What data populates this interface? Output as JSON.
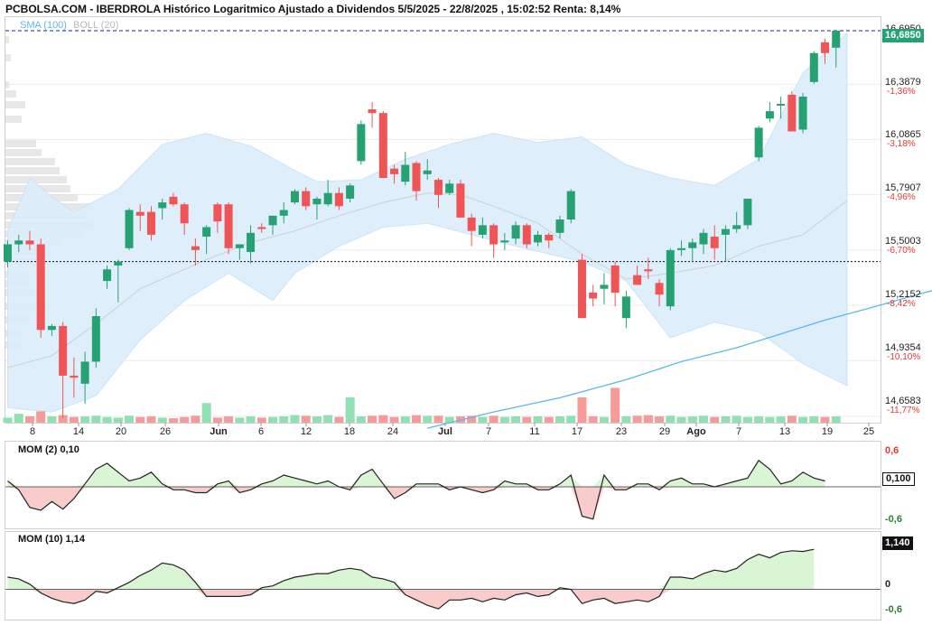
{
  "title": "PCBOLSA.COM - IBERDROLA Histórico Logaritmico Ajustado a Dividendos 5/5/2025 - 22/8/2025 , 15:02:52 Renta: 8,14%",
  "legend": {
    "sma": "SMA (100)",
    "boll": "BOLL (20)"
  },
  "colors": {
    "up": "#26a172",
    "down": "#f05454",
    "sma": "#5bb8ec",
    "band": "#dcedfb",
    "mom_pos": "#d9f5d3",
    "mom_neg": "#f9cccc"
  },
  "chart_data": [
    {
      "type": "candlestick",
      "ylim": [
        14.6583,
        16.695
      ],
      "y_scale": "log",
      "y_ticks": [
        {
          "value": "16,6950",
          "pct": ""
        },
        {
          "value": "16,3879",
          "pct": "-1,36%"
        },
        {
          "value": "16,0865",
          "pct": "-3,18%"
        },
        {
          "value": "15,7907",
          "pct": "-4,96%"
        },
        {
          "value": "15,5003",
          "pct": "-6,70%"
        },
        {
          "value": "15,2152",
          "pct": "-8,42%"
        },
        {
          "value": "14,9354",
          "pct": "-10,10%"
        },
        {
          "value": "14,6583",
          "pct": "-11,77%"
        }
      ],
      "x_ticks": [
        {
          "label": "8",
          "month": false
        },
        {
          "label": "14",
          "month": false
        },
        {
          "label": "20",
          "month": false
        },
        {
          "label": "26",
          "month": false
        },
        {
          "label": "Jun",
          "month": true
        },
        {
          "label": "6",
          "month": false
        },
        {
          "label": "12",
          "month": false
        },
        {
          "label": "18",
          "month": false
        },
        {
          "label": "24",
          "month": false
        },
        {
          "label": "Jul",
          "month": true
        },
        {
          "label": "7",
          "month": false
        },
        {
          "label": "11",
          "month": false
        },
        {
          "label": "17",
          "month": false
        },
        {
          "label": "23",
          "month": false
        },
        {
          "label": "29",
          "month": false
        },
        {
          "label": "Ago",
          "month": true
        },
        {
          "label": "7",
          "month": false
        },
        {
          "label": "13",
          "month": false
        },
        {
          "label": "19",
          "month": false
        },
        {
          "label": "25",
          "month": false
        }
      ],
      "last_price": "16,6850",
      "reference_level": 15.44,
      "candles": [
        [
          15.44,
          15.55,
          15.41,
          15.53,
          8
        ],
        [
          15.53,
          15.58,
          15.49,
          15.55,
          14
        ],
        [
          15.55,
          15.6,
          15.5,
          15.53,
          10
        ],
        [
          15.53,
          15.56,
          15.05,
          15.09,
          18
        ],
        [
          15.09,
          15.12,
          15.06,
          15.11,
          10
        ],
        [
          15.11,
          15.13,
          14.65,
          14.86,
          12
        ],
        [
          14.86,
          14.95,
          14.75,
          14.85,
          9
        ],
        [
          14.82,
          14.98,
          14.72,
          14.93,
          10
        ],
        [
          14.93,
          15.2,
          14.9,
          15.16,
          11
        ],
        [
          15.34,
          15.42,
          15.3,
          15.4,
          9
        ],
        [
          15.42,
          15.45,
          15.23,
          15.44,
          8
        ],
        [
          15.51,
          15.72,
          15.5,
          15.71,
          11
        ],
        [
          15.7,
          15.74,
          15.6,
          15.68,
          9
        ],
        [
          15.7,
          15.73,
          15.55,
          15.58,
          10
        ],
        [
          15.72,
          15.77,
          15.66,
          15.75,
          8
        ],
        [
          15.78,
          15.8,
          15.73,
          15.74,
          7
        ],
        [
          15.74,
          15.75,
          15.58,
          15.64,
          9
        ],
        [
          15.52,
          15.56,
          15.42,
          15.5,
          11
        ],
        [
          15.57,
          15.63,
          15.48,
          15.62,
          31
        ],
        [
          15.74,
          15.75,
          15.59,
          15.65,
          8
        ],
        [
          15.74,
          15.75,
          15.48,
          15.51,
          10
        ],
        [
          15.51,
          15.53,
          15.45,
          15.53,
          8
        ],
        [
          15.49,
          15.63,
          15.43,
          15.59,
          10
        ],
        [
          15.62,
          15.64,
          15.59,
          15.61,
          8
        ],
        [
          15.63,
          15.68,
          15.58,
          15.68,
          9
        ],
        [
          15.68,
          15.75,
          15.64,
          15.71,
          10
        ],
        [
          15.75,
          15.82,
          15.74,
          15.81,
          12
        ],
        [
          15.81,
          15.83,
          15.71,
          15.73,
          11
        ],
        [
          15.74,
          15.78,
          15.66,
          15.77,
          10
        ],
        [
          15.74,
          15.87,
          15.73,
          15.8,
          12
        ],
        [
          15.8,
          15.83,
          15.71,
          15.73,
          9
        ],
        [
          15.77,
          15.85,
          15.75,
          15.84,
          40
        ],
        [
          15.97,
          16.19,
          15.95,
          16.17,
          10
        ],
        [
          16.25,
          16.29,
          16.15,
          16.23,
          11
        ],
        [
          16.23,
          16.24,
          15.88,
          15.88,
          12
        ],
        [
          15.93,
          15.95,
          15.85,
          15.9,
          9
        ],
        [
          15.86,
          16.02,
          15.84,
          15.95,
          10
        ],
        [
          15.96,
          15.97,
          15.76,
          15.81,
          12
        ],
        [
          15.9,
          15.98,
          15.87,
          15.92,
          11
        ],
        [
          15.87,
          15.88,
          15.72,
          15.79,
          11
        ],
        [
          15.8,
          15.87,
          15.79,
          15.85,
          9
        ],
        [
          15.85,
          15.87,
          15.67,
          15.67,
          10
        ],
        [
          15.67,
          15.69,
          15.52,
          15.6,
          11
        ],
        [
          15.58,
          15.67,
          15.56,
          15.63,
          9
        ],
        [
          15.63,
          15.64,
          15.46,
          15.53,
          11
        ],
        [
          15.54,
          15.59,
          15.5,
          15.55,
          9
        ],
        [
          15.56,
          15.65,
          15.53,
          15.63,
          10
        ],
        [
          15.63,
          15.64,
          15.51,
          15.53,
          9
        ],
        [
          15.54,
          15.6,
          15.52,
          15.58,
          10
        ],
        [
          15.58,
          15.59,
          15.51,
          15.55,
          9
        ],
        [
          15.59,
          15.68,
          15.56,
          15.66,
          10
        ],
        [
          15.66,
          15.82,
          15.64,
          15.81,
          11
        ],
        [
          15.45,
          15.48,
          15.15,
          15.15,
          40
        ],
        [
          15.28,
          15.32,
          15.21,
          15.25,
          10
        ],
        [
          15.3,
          15.38,
          15.22,
          15.32,
          9
        ],
        [
          15.42,
          15.44,
          15.21,
          15.28,
          55
        ],
        [
          15.15,
          15.29,
          15.1,
          15.26,
          10
        ],
        [
          15.37,
          15.42,
          15.32,
          15.32,
          11
        ],
        [
          15.4,
          15.46,
          15.35,
          15.39,
          12
        ],
        [
          15.33,
          15.35,
          15.21,
          15.27,
          10
        ],
        [
          15.21,
          15.51,
          15.19,
          15.5,
          11
        ],
        [
          15.5,
          15.55,
          15.47,
          15.51,
          9
        ],
        [
          15.51,
          15.56,
          15.44,
          15.54,
          10
        ],
        [
          15.53,
          15.61,
          15.48,
          15.59,
          11
        ],
        [
          15.57,
          15.63,
          15.45,
          15.51,
          9
        ],
        [
          15.58,
          15.63,
          15.44,
          15.61,
          10
        ],
        [
          15.61,
          15.7,
          15.59,
          15.63,
          11
        ],
        [
          15.63,
          15.77,
          15.61,
          15.77,
          9
        ],
        [
          15.99,
          16.16,
          15.97,
          16.15,
          10
        ],
        [
          16.2,
          16.29,
          16.18,
          16.24,
          9
        ],
        [
          16.27,
          16.32,
          16.2,
          16.28,
          10
        ],
        [
          16.33,
          16.35,
          16.13,
          16.13,
          11
        ],
        [
          16.14,
          16.34,
          16.12,
          16.32,
          9
        ],
        [
          16.4,
          16.57,
          16.39,
          16.56,
          10
        ],
        [
          16.62,
          16.64,
          16.5,
          16.56,
          9
        ],
        [
          16.59,
          16.68,
          16.48,
          16.685,
          10
        ]
      ],
      "sma100": [
        [
          38,
          14.6
        ],
        [
          44,
          14.68
        ],
        [
          50,
          14.75
        ],
        [
          56,
          14.84
        ],
        [
          61,
          14.93
        ],
        [
          66,
          15.0
        ],
        [
          70,
          15.07
        ],
        [
          74,
          15.14
        ],
        [
          78,
          15.2
        ],
        [
          83,
          15.28
        ],
        [
          87,
          15.34
        ],
        [
          91,
          15.4
        ],
        [
          96,
          15.47
        ]
      ],
      "boll_mid": [
        [
          0,
          14.9
        ],
        [
          4,
          14.96
        ],
        [
          8,
          15.12
        ],
        [
          12,
          15.3
        ],
        [
          18,
          15.45
        ],
        [
          22,
          15.54
        ],
        [
          26,
          15.6
        ],
        [
          30,
          15.68
        ],
        [
          34,
          15.75
        ],
        [
          38,
          15.8
        ],
        [
          41,
          15.79
        ],
        [
          44,
          15.73
        ],
        [
          48,
          15.64
        ],
        [
          52,
          15.48
        ],
        [
          56,
          15.35
        ],
        [
          60,
          15.38
        ],
        [
          64,
          15.42
        ],
        [
          68,
          15.52
        ],
        [
          72,
          15.58
        ],
        [
          76,
          15.76
        ]
      ],
      "boll_upper": [
        [
          0,
          15.6
        ],
        [
          2,
          15.88
        ],
        [
          4,
          15.78
        ],
        [
          6,
          15.7
        ],
        [
          10,
          15.82
        ],
        [
          14,
          16.06
        ],
        [
          18,
          16.12
        ],
        [
          22,
          16.05
        ],
        [
          26,
          15.92
        ],
        [
          28,
          15.86
        ],
        [
          32,
          15.87
        ],
        [
          36,
          15.98
        ],
        [
          40,
          16.06
        ],
        [
          44,
          16.12
        ],
        [
          48,
          16.07
        ],
        [
          52,
          16.1
        ],
        [
          56,
          15.95
        ],
        [
          60,
          15.88
        ],
        [
          64,
          15.84
        ],
        [
          68,
          15.98
        ],
        [
          72,
          16.45
        ],
        [
          76,
          16.67
        ]
      ],
      "boll_lower": [
        [
          0,
          14.7
        ],
        [
          4,
          14.68
        ],
        [
          8,
          14.76
        ],
        [
          12,
          15.04
        ],
        [
          16,
          15.24
        ],
        [
          20,
          15.38
        ],
        [
          24,
          15.24
        ],
        [
          26,
          15.38
        ],
        [
          30,
          15.52
        ],
        [
          34,
          15.62
        ],
        [
          38,
          15.64
        ],
        [
          42,
          15.58
        ],
        [
          46,
          15.52
        ],
        [
          52,
          15.44
        ],
        [
          56,
          15.34
        ],
        [
          60,
          15.05
        ],
        [
          64,
          15.13
        ],
        [
          68,
          15.08
        ],
        [
          72,
          14.92
        ],
        [
          76,
          14.81
        ]
      ]
    },
    {
      "type": "line",
      "name": "MOM (2)",
      "label_text": "MOM (2)  0,10",
      "ylim": [
        -0.6,
        0.6
      ],
      "y_ticks": [
        "0,6",
        "-0,6"
      ],
      "last": "0,100",
      "values": [
        0.1,
        -0.05,
        -0.35,
        -0.4,
        -0.25,
        -0.38,
        -0.2,
        0.05,
        0.3,
        0.4,
        0.25,
        0.1,
        0.15,
        0.25,
        0.05,
        -0.05,
        -0.05,
        -0.1,
        -0.1,
        0.05,
        0.1,
        -0.1,
        -0.05,
        0.05,
        0.1,
        0.2,
        0.15,
        0.1,
        0.05,
        0.1,
        0.0,
        -0.05,
        0.2,
        0.3,
        0.05,
        -0.2,
        -0.1,
        0.05,
        0.05,
        0.05,
        -0.05,
        0.0,
        -0.05,
        -0.1,
        -0.05,
        0.1,
        0.05,
        0.05,
        -0.05,
        -0.05,
        0.05,
        0.2,
        -0.5,
        -0.55,
        0.2,
        -0.05,
        -0.05,
        0.05,
        0.05,
        -0.05,
        0.1,
        0.15,
        0.05,
        0.05,
        0.0,
        0.05,
        0.1,
        0.15,
        0.45,
        0.3,
        0.05,
        0.1,
        0.25,
        0.15,
        0.1
      ]
    },
    {
      "type": "line",
      "name": "MOM (10)",
      "label_text": "MOM (10)  1,14",
      "ylim": [
        -0.6,
        1.3
      ],
      "y_ticks": [
        "0",
        "-0,6"
      ],
      "last": "1,140",
      "values": [
        0.35,
        0.3,
        0.15,
        -0.1,
        -0.25,
        -0.35,
        -0.4,
        -0.3,
        -0.05,
        -0.1,
        0.05,
        0.2,
        0.4,
        0.55,
        0.75,
        0.7,
        0.55,
        0.2,
        -0.2,
        -0.2,
        -0.2,
        -0.2,
        -0.15,
        0.05,
        0.1,
        0.25,
        0.35,
        0.4,
        0.45,
        0.45,
        0.55,
        0.6,
        0.55,
        0.35,
        0.3,
        0.2,
        -0.15,
        -0.3,
        -0.45,
        -0.55,
        -0.3,
        -0.3,
        -0.25,
        -0.35,
        -0.25,
        -0.3,
        -0.15,
        -0.1,
        -0.2,
        -0.15,
        0.05,
        0.0,
        -0.4,
        -0.3,
        -0.25,
        -0.4,
        -0.35,
        -0.3,
        -0.35,
        -0.2,
        0.35,
        0.35,
        0.3,
        0.45,
        0.55,
        0.5,
        0.6,
        0.85,
        1.0,
        0.9,
        1.05,
        1.1,
        1.08,
        1.14
      ]
    }
  ]
}
